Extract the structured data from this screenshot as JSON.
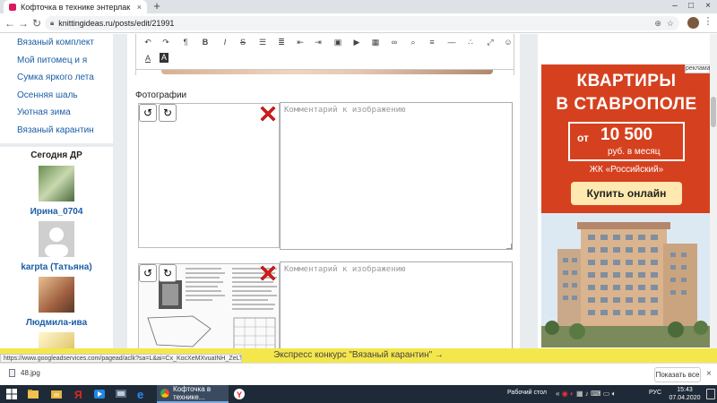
{
  "browser": {
    "tab_title": "Кофточка в технике энтерлак",
    "url": "knittingideas.ru/posts/edit/21991",
    "new_tab": "+",
    "tab_close": "×",
    "win_min": "–",
    "win_max": "□",
    "win_close": "×"
  },
  "sidebar": {
    "menu": [
      {
        "label": "Вязаный комплект"
      },
      {
        "label": "Мой питомец и я"
      },
      {
        "label": "Сумка яркого лета"
      },
      {
        "label": "Осенняя шаль"
      },
      {
        "label": "Уютная зима"
      },
      {
        "label": "Вязаный карантин"
      }
    ],
    "birthdays_title": "Сегодня ДР",
    "birthdays": [
      {
        "name": "Ирина_0704"
      },
      {
        "name": "karpta (Татьяна)"
      },
      {
        "name": "Людмила-ива"
      }
    ]
  },
  "editor": {
    "photos_label": "Фотографии",
    "photos": [
      {
        "comment_placeholder": "Комментарий к изображению"
      },
      {
        "comment_placeholder": "Комментарий к изображению"
      }
    ]
  },
  "ad": {
    "corner_label": "реклама",
    "title_line1": "КВАРТИРЫ",
    "title_line2": "В СТАВРОПОЛЕ",
    "price_from": "от",
    "price_value": "10 500",
    "price_unit": "руб. в месяц",
    "complex": "ЖК «Российский»",
    "cta": "Купить онлайн",
    "colors": {
      "background": "#d5411f",
      "cta": "#ffe9b0"
    }
  },
  "status_url": "https://www.googleadservices.com/pagead/aclk?sa=L&ai=Cx_KocXeMXvuaINH_ZeLTj_AEob3yv1...",
  "contest_bar": "Экспресс конкурс \"Вязаный карантин\" →",
  "downloads": {
    "file": "48.jpg",
    "show_all": "Показать все",
    "close": "×"
  },
  "taskbar": {
    "active_window": "Кофточка в технике...",
    "desktop_label": "Рабочий стол",
    "language": "РУС",
    "time": "15:43",
    "date": "07.04.2020"
  }
}
